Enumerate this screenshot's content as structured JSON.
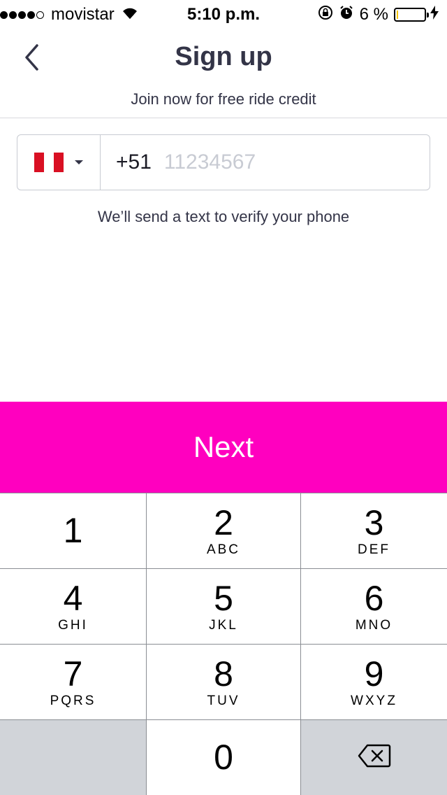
{
  "status_bar": {
    "carrier": "movistar",
    "time": "5:10 p.m.",
    "battery": "6 %",
    "battery_level": 0.06,
    "battery_color": "#f6c400",
    "icons": [
      "signal-dots-icon",
      "wifi-icon",
      "rotation-lock-icon",
      "alarm-icon",
      "battery-icon",
      "charging-icon"
    ]
  },
  "header": {
    "back_icon": "chevron-left-icon",
    "title": "Sign up",
    "subtitle": "Join now for free ride credit"
  },
  "phone_input": {
    "country_flag": "peru-flag-icon",
    "flag_colors": [
      "#d91023",
      "#ffffff",
      "#d91023"
    ],
    "dial_code": "+51",
    "value": "",
    "placeholder": "11234567"
  },
  "helper_text": "We’ll send a text to verify your phone",
  "next_button": {
    "label": "Next",
    "color": "#ff00bf"
  },
  "keypad": {
    "keys": [
      {
        "digit": "1",
        "letters": ""
      },
      {
        "digit": "2",
        "letters": "ABC"
      },
      {
        "digit": "3",
        "letters": "DEF"
      },
      {
        "digit": "4",
        "letters": "GHI"
      },
      {
        "digit": "5",
        "letters": "JKL"
      },
      {
        "digit": "6",
        "letters": "MNO"
      },
      {
        "digit": "7",
        "letters": "PQRS"
      },
      {
        "digit": "8",
        "letters": "TUV"
      },
      {
        "digit": "9",
        "letters": "WXYZ"
      },
      {
        "digit": "0",
        "letters": ""
      }
    ],
    "delete_icon": "backspace-icon"
  }
}
